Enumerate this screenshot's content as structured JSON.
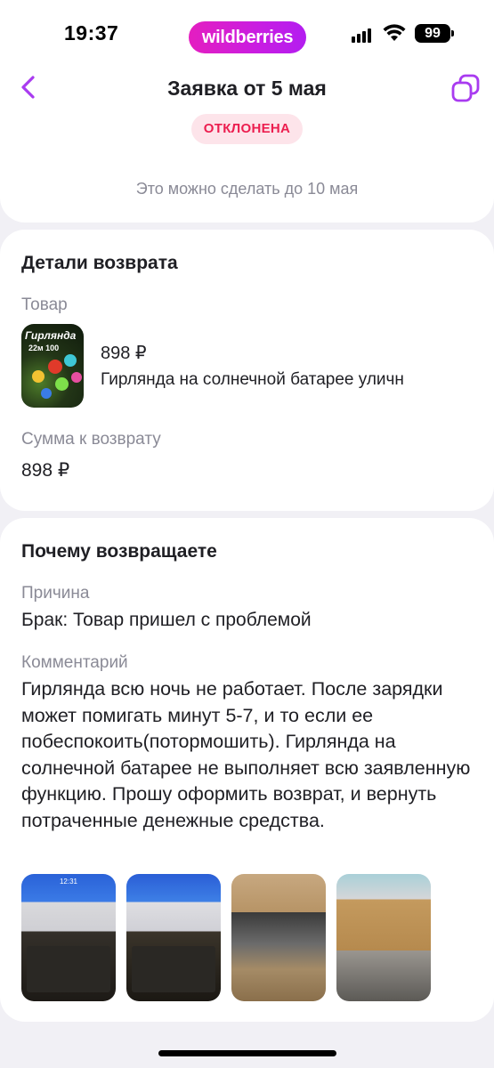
{
  "status_bar": {
    "time": "19:37",
    "brand": "wildberries",
    "battery": "99",
    "signal_icon": "cellular-signal-icon",
    "wifi_icon": "wifi-icon"
  },
  "header": {
    "title": "Заявка от 5 мая",
    "back_icon": "chevron-left-icon",
    "copy_icon": "copy-icon",
    "status": "ОТКЛОНЕНА",
    "deadline": "Это можно сделать до 10 мая"
  },
  "details": {
    "title": "Детали возврата",
    "product_label": "Товар",
    "product": {
      "price": "898 ₽",
      "name": "Гирлянда на солнечной батарее уличн",
      "thumb_title": "Гирлянда",
      "thumb_sub": "22м 100"
    },
    "refund_label": "Сумма к возврату",
    "refund_amount": "898 ₽"
  },
  "reason": {
    "title": "Почему возвращаете",
    "reason_label": "Причина",
    "reason_value": "Брак: Товар пришел с проблемой",
    "comment_label": "Комментарий",
    "comment": "Гирлянда всю ночь не работает. После зарядки может помигать минут 5-7, и то если ее побеспокоить(потормошить). Гирлянда на солнечной батарее не выполняет всю заявленную функцию. Прошу оформить возврат, и вернуть потраченные денежные средства.",
    "photos": [
      {
        "clock": "12:31"
      },
      {
        "clock": ""
      },
      {
        "clock": ""
      },
      {
        "clock": ""
      }
    ]
  },
  "colors": {
    "accent": "#a93bf0",
    "status_text": "#ec1e4f",
    "status_bg": "#fde4ea",
    "background": "#f1f0f5"
  }
}
